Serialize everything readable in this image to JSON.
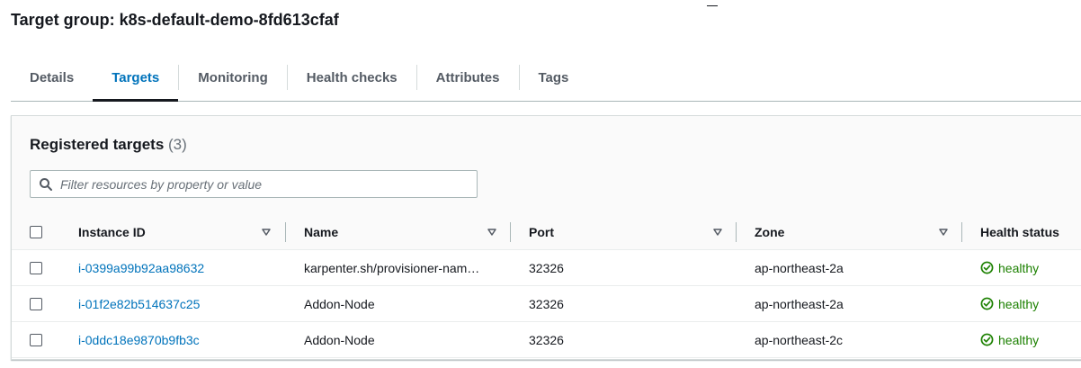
{
  "page": {
    "title": "Target group: k8s-default-demo-8fd613cfaf"
  },
  "tabs": [
    {
      "label": "Details",
      "active": false
    },
    {
      "label": "Targets",
      "active": true
    },
    {
      "label": "Monitoring",
      "active": false
    },
    {
      "label": "Health checks",
      "active": false
    },
    {
      "label": "Attributes",
      "active": false
    },
    {
      "label": "Tags",
      "active": false
    }
  ],
  "panel": {
    "title": "Registered targets",
    "count": "(3)",
    "filter_placeholder": "Filter resources by property or value"
  },
  "table": {
    "columns": [
      "Instance ID",
      "Name",
      "Port",
      "Zone",
      "Health status"
    ],
    "rows": [
      {
        "instance_id": "i-0399a99b92aa98632",
        "name": "karpenter.sh/provisioner-nam…",
        "port": "32326",
        "zone": "ap-northeast-2a",
        "health": "healthy"
      },
      {
        "instance_id": "i-01f2e82b514637c25",
        "name": "Addon-Node",
        "port": "32326",
        "zone": "ap-northeast-2a",
        "health": "healthy"
      },
      {
        "instance_id": "i-0ddc18e9870b9fb3c",
        "name": "Addon-Node",
        "port": "32326",
        "zone": "ap-northeast-2c",
        "health": "healthy"
      }
    ]
  },
  "colors": {
    "accent": "#0073bb",
    "healthy": "#1d8102",
    "text": "#16191f",
    "muted": "#545b64"
  },
  "icons": {
    "filter": "search-icon",
    "sort": "caret-down-icon",
    "health": "check-circle-icon"
  }
}
